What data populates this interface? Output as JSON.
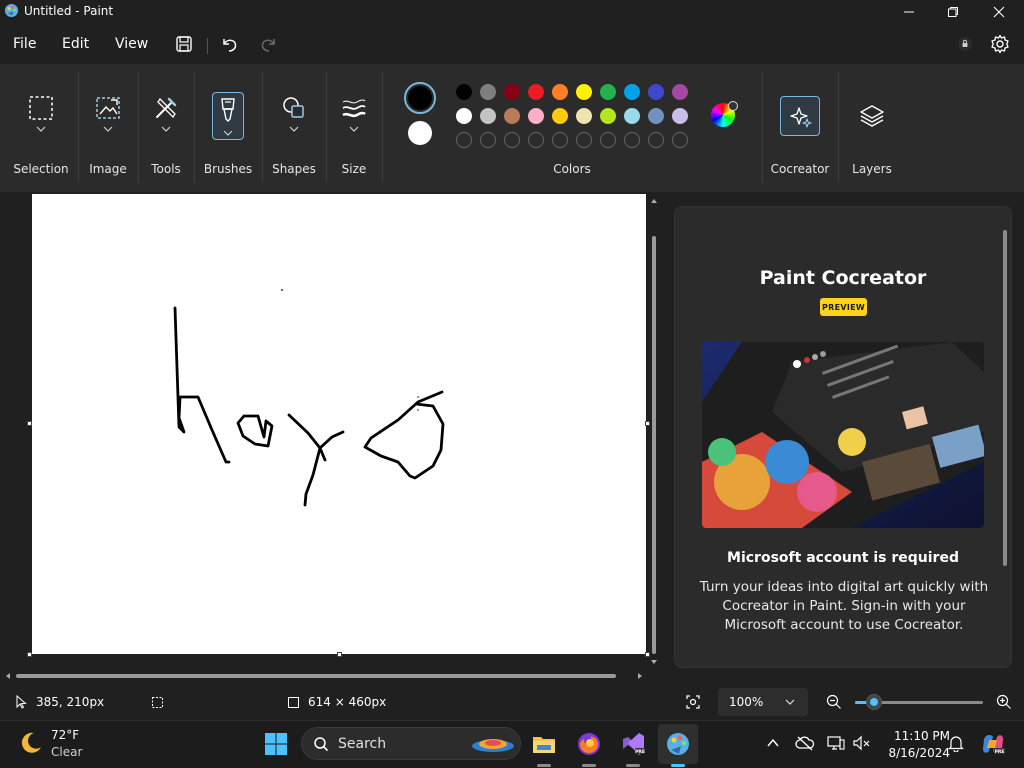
{
  "window": {
    "title": "Untitled - Paint"
  },
  "menu": {
    "file": "File",
    "edit": "Edit",
    "view": "View"
  },
  "ribbon": {
    "groups": [
      {
        "label": "Selection",
        "icon": "selection-icon"
      },
      {
        "label": "Image",
        "icon": "image-icon"
      },
      {
        "label": "Tools",
        "icon": "tools-icon"
      },
      {
        "label": "Brushes",
        "icon": "brush-icon"
      },
      {
        "label": "Shapes",
        "icon": "shapes-icon"
      },
      {
        "label": "Size",
        "icon": "size-icon"
      },
      {
        "label": "Colors",
        "icon": "palette"
      },
      {
        "label": "Cocreator",
        "icon": "cocreator-icon"
      },
      {
        "label": "Layers",
        "icon": "layers-icon"
      }
    ],
    "primary_color": "#000000",
    "secondary_color": "#ffffff",
    "palette_row1": [
      "#000000",
      "#7f7f7f",
      "#880015",
      "#ed1c24",
      "#ff7f27",
      "#fff200",
      "#22b14c",
      "#00a2e8",
      "#3f48cc",
      "#a349a4"
    ],
    "palette_row2": [
      "#ffffff",
      "#c3c3c3",
      "#b97a57",
      "#ffaec9",
      "#ffc90e",
      "#efe4b0",
      "#b5e61d",
      "#99d9ea",
      "#7092be",
      "#c8bfe7"
    ],
    "accent": "#7ab8de"
  },
  "cocreator_panel": {
    "title": "Paint Cocreator",
    "badge": "PREVIEW",
    "subtitle": "Microsoft account is required",
    "body": "Turn your ideas into digital art quickly with Cocreator in Paint. Sign-in with your Microsoft account to use Cocreator."
  },
  "status": {
    "cursor_position": "385, 210px",
    "canvas_size": "614 × 460px",
    "zoom": "100%",
    "zoom_level": 0.15
  },
  "taskbar": {
    "temperature": "72°F",
    "weather": "Clear",
    "search_placeholder": "Search",
    "time": "11:10 PM",
    "date": "8/16/2024"
  }
}
